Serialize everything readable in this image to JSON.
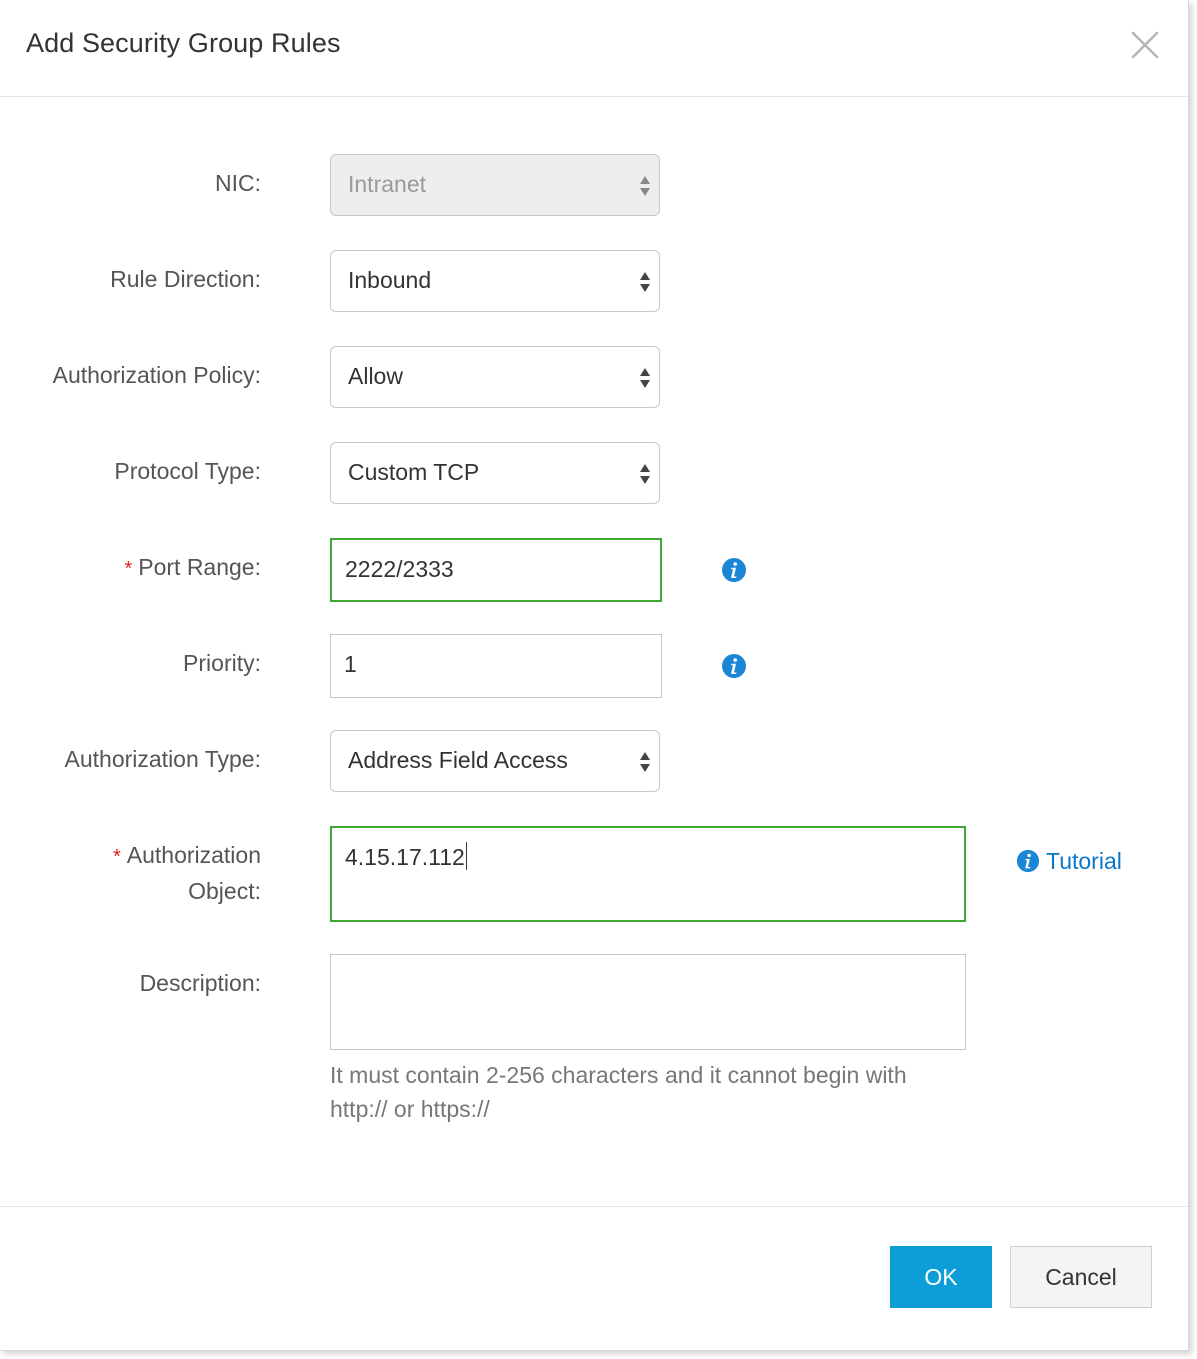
{
  "dialog": {
    "title": "Add Security Group Rules"
  },
  "form": {
    "nic": {
      "label": "NIC:",
      "value": "Intranet"
    },
    "rule_direction": {
      "label": "Rule Direction:",
      "value": "Inbound"
    },
    "authorization_policy": {
      "label": "Authorization Policy:",
      "value": "Allow"
    },
    "protocol_type": {
      "label": "Protocol Type:",
      "value": "Custom TCP"
    },
    "port_range": {
      "required_mark": "*",
      "label": "Port Range:",
      "value": "2222/2333"
    },
    "priority": {
      "label": "Priority:",
      "value": "1"
    },
    "authorization_type": {
      "label": "Authorization Type:",
      "value": "Address Field Access"
    },
    "authorization_object": {
      "required_mark": "*",
      "label_line1": "Authorization",
      "label_line2": "Object:",
      "value": "4.15.17.112",
      "tutorial_label": "Tutorial"
    },
    "description": {
      "label": "Description:",
      "value": "",
      "hint_line1": "It must contain 2-256 characters and it cannot begin with",
      "hint_line2": "http:// or https://"
    }
  },
  "footer": {
    "ok_label": "OK",
    "cancel_label": "Cancel"
  },
  "colors": {
    "primary_button": "#0d9ed8",
    "valid_border": "#3fa535",
    "info_icon": "#1b86d6",
    "link": "#0a77c9",
    "required": "#e02020"
  },
  "icons": {
    "close": "close-icon",
    "info": "info-icon",
    "select_arrows": "select-arrows-icon"
  }
}
